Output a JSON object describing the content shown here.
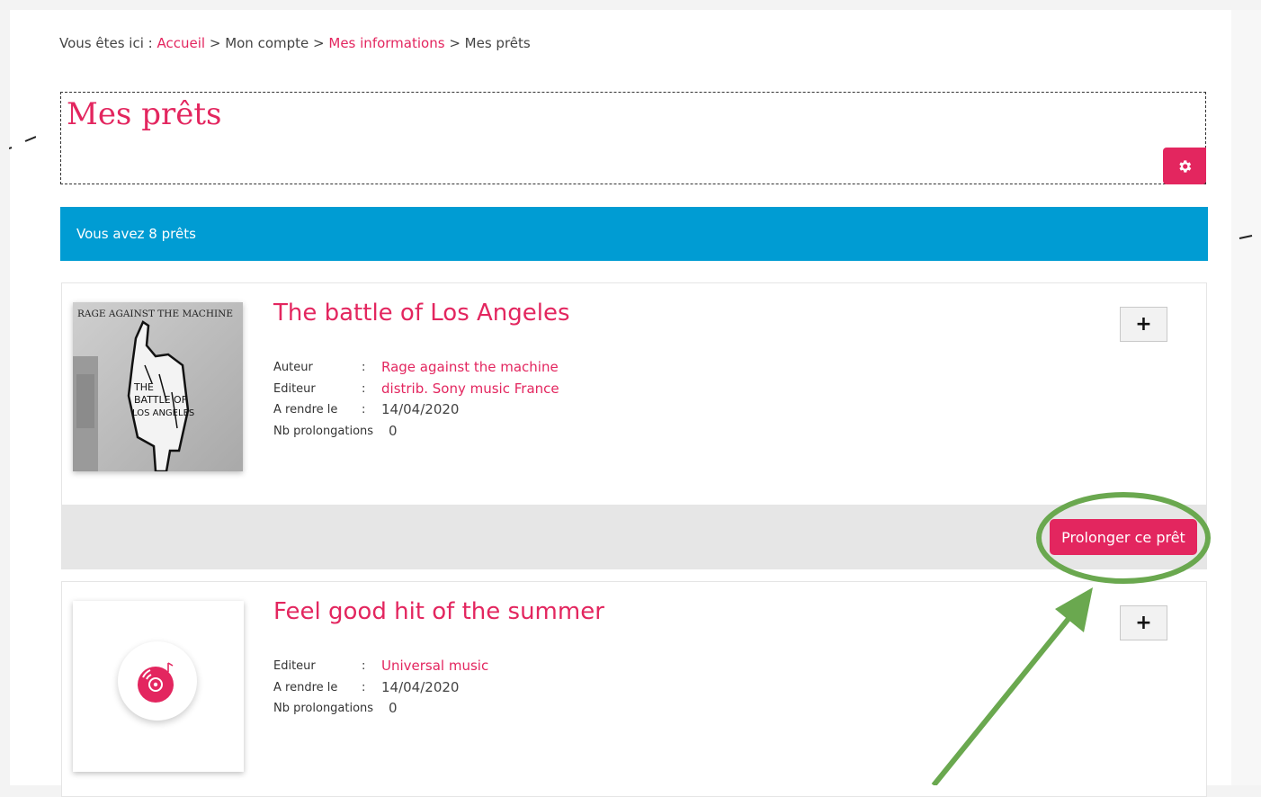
{
  "breadcrumb": {
    "prefix": "Vous êtes ici :",
    "home": "Accueil",
    "sep1": ">",
    "account": "Mon compte",
    "sep2": ">",
    "info": "Mes informations",
    "sep3": ">",
    "current": "Mes prêts"
  },
  "page_title": "Mes prêts",
  "settings_icon": "gear-icon",
  "banner_text": "Vous avez 8 prêts",
  "loans": [
    {
      "title": "The battle of Los Angeles",
      "cover_text_top": "RAGE AGAINST THE MACHINE",
      "cover_text_hand": [
        "THE",
        "BATTLE OF",
        "LOS ANGELES"
      ],
      "fields": {
        "author_label": "Auteur",
        "author_value": "Rage against the machine",
        "publisher_label": "Editeur",
        "publisher_value": "distrib. Sony music France",
        "due_label": "A rendre le",
        "due_value": "14/04/2020",
        "renewals_label": "Nb prolongations",
        "renewals_value": "0",
        "colon": ":"
      },
      "expand_label": "+",
      "extend_label": "Prolonger ce prêt"
    },
    {
      "title": "Feel good hit of the summer",
      "cover_icon": "music-disc-icon",
      "fields": {
        "publisher_label": "Editeur",
        "publisher_value": "Universal music",
        "due_label": "A rendre le",
        "due_value": "14/04/2020",
        "renewals_label": "Nb prolongations",
        "renewals_value": "0",
        "colon": ":"
      },
      "expand_label": "+"
    }
  ],
  "colors": {
    "accent": "#e3265f",
    "banner": "#009cd3",
    "annotation": "#6aa84f"
  }
}
